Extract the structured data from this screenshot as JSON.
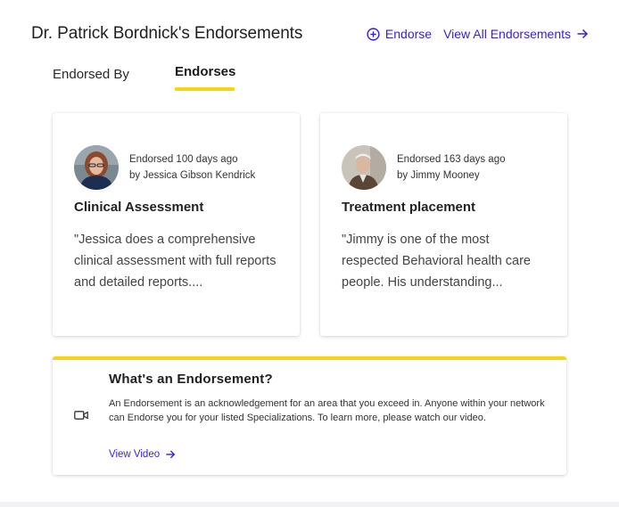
{
  "header": {
    "title": "Dr. Patrick Bordnick's Endorsements",
    "endorse_label": "Endorse",
    "view_all_label": "View All Endorsements"
  },
  "tabs": [
    {
      "label": "Endorsed By",
      "active": false
    },
    {
      "label": "Endorses",
      "active": true
    }
  ],
  "cards": [
    {
      "endorsed_when": "Endorsed 100 days ago",
      "by": "by Jessica Gibson Kendrick",
      "title": "Clinical Assessment",
      "quote": "\"Jessica does a comprehensive clinical assessment with full reports and detailed reports...."
    },
    {
      "endorsed_when": "Endorsed 163 days ago",
      "by": "by Jimmy Mooney",
      "title": "Treatment placement",
      "quote": "\"Jimmy is one of the most respected Behavioral health care people. His understanding..."
    }
  ],
  "info": {
    "title": "What's an Endorsement?",
    "text": "An Endorsement is an acknowledgement for an area that you exceed in. Anyone within your network can Endorse you for your listed Specializations. To learn more, please watch our video.",
    "link_label": "View Video"
  },
  "colors": {
    "accent": "#3b1fc9",
    "highlight": "#f7d417"
  },
  "icons": {
    "endorse": "plus-circle-icon",
    "view_all": "arrow-right-icon",
    "video": "video-camera-icon",
    "view_video": "arrow-right-icon"
  }
}
